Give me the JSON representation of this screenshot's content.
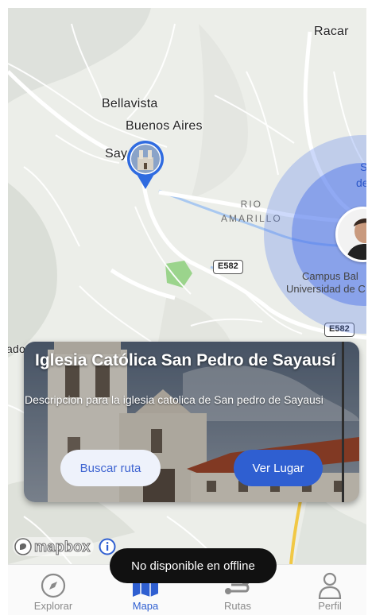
{
  "map": {
    "places": [
      "Racar",
      "Bellavista",
      "Buenos Aires",
      "Say"
    ],
    "road_name": "RIO\nAMARILLO",
    "campus_line1": "Campus Bal",
    "campus_line2": "Universidad de C",
    "highway_1": "E582",
    "highway_2": "E582",
    "left_cut_label": "ado",
    "edge_fragment_1": "S",
    "edge_fragment_2": "de"
  },
  "card": {
    "title": "Iglesia Católica San Pedro de Sayausí",
    "description": "Descripcion para la iglesia catolica de San pedro de Sayausi",
    "route_button": "Buscar ruta",
    "view_button": "Ver Lugar"
  },
  "attribution": {
    "brand": "mapbox",
    "info_icon": "info-icon"
  },
  "toast": {
    "message": "No disponible en offline"
  },
  "nav": {
    "items": [
      {
        "label": "Explorar",
        "icon": "compass-icon",
        "active": false
      },
      {
        "label": "Mapa",
        "icon": "map-icon",
        "active": true
      },
      {
        "label": "Rutas",
        "icon": "route-icon",
        "active": false
      },
      {
        "label": "Perfil",
        "icon": "person-icon",
        "active": false
      }
    ]
  },
  "colors": {
    "accent": "#2f5fd1",
    "map_water": "#a9c8f0",
    "map_park": "#9bd48c",
    "toast_bg": "#111111"
  }
}
